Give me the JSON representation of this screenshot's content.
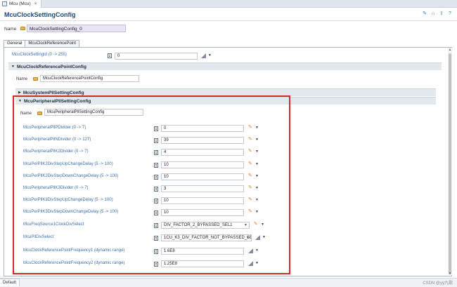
{
  "editor_tab": {
    "title": "Mcu (Mcu)",
    "close_symbol": "×"
  },
  "header": {
    "title": "McuClockSettingConfig",
    "tools": [
      {
        "icon": "pencil-icon",
        "glyph": "✎"
      },
      {
        "icon": "home-icon",
        "glyph": "⌂"
      },
      {
        "icon": "up-arrow-icon",
        "glyph": "⇧"
      },
      {
        "icon": "help-icon",
        "glyph": "?"
      }
    ]
  },
  "top_name": {
    "label": "Name",
    "value": "McuClockSettingConfig_0"
  },
  "sub_tabs": [
    {
      "label": "General",
      "active": true
    },
    {
      "label": "McuClockReferencePoint",
      "active": false
    }
  ],
  "setting_id": {
    "label": "McuClockSettingId (0 -> 255)",
    "value": "0"
  },
  "sections": {
    "reference_point": {
      "title": "McuClockReferencePointConfig",
      "twisty": "▼",
      "name_label": "Name",
      "name_value": "McuClockReferencePointConfig"
    },
    "system_pll": {
      "title": "McuSystemPllSettingConfig",
      "twisty": "▶"
    },
    "peripheral_pll": {
      "title": "McuPeripheralPllSettingConfig",
      "twisty": "▼",
      "name_label": "Name",
      "name_value": "McuPeripheralPllSettingConfig"
    }
  },
  "params": [
    {
      "label": "McuPeripheralPllPDivider (0 -> 7)",
      "value": "0",
      "control": "pencil"
    },
    {
      "label": "McuPeripheralPllNDivider (0 -> 127)",
      "value": "39",
      "control": "pencil"
    },
    {
      "label": "McuPeripheralPllK2Divider (0 -> 7)",
      "value": "4",
      "control": "pencil"
    },
    {
      "label": "McuPerPllK2DivStepUpChangeDelay (5 -> 100)",
      "value": "10",
      "control": "pencil"
    },
    {
      "label": "McuPerPllK2DivStepDownChangeDelay (5 -> 100)",
      "value": "10",
      "control": "pencil"
    },
    {
      "label": "McuPeripheralPllK3Divider (0 -> 7)",
      "value": "3",
      "control": "pencil"
    },
    {
      "label": "McuPerPllK3DivStepUpChangeDelay (5 -> 100)",
      "value": "10",
      "control": "pencil"
    },
    {
      "label": "McuPerPllK3DivStepDownChangeDelay (5 -> 100)",
      "value": "10",
      "control": "pencil"
    },
    {
      "label": "McuFreqSource1ClockDivSelect",
      "value": "DIV_FACTOR_2_BYPASSED_SEL1",
      "control": "select-pencil"
    },
    {
      "label": "McuPllDivSelect",
      "value": "1CU_K3_DIV_FACTOR_NOT_BYPASSED_SEL0",
      "control": "select-calc"
    },
    {
      "label": "McuClockReferencePointFrequency1 (dynamic range)",
      "value": "1.6E8",
      "control": "calc"
    },
    {
      "label": "McuClockReferencePointFrequency2 (dynamic range)",
      "value": "1.25E8",
      "control": "calc"
    }
  ],
  "status": {
    "tab_label": "Default"
  },
  "watermark": "CSDN @yy九歌",
  "colors": {
    "accent_title": "#1b4a7e",
    "param_label": "#3a6fb6",
    "highlight": "#d22b2b"
  }
}
